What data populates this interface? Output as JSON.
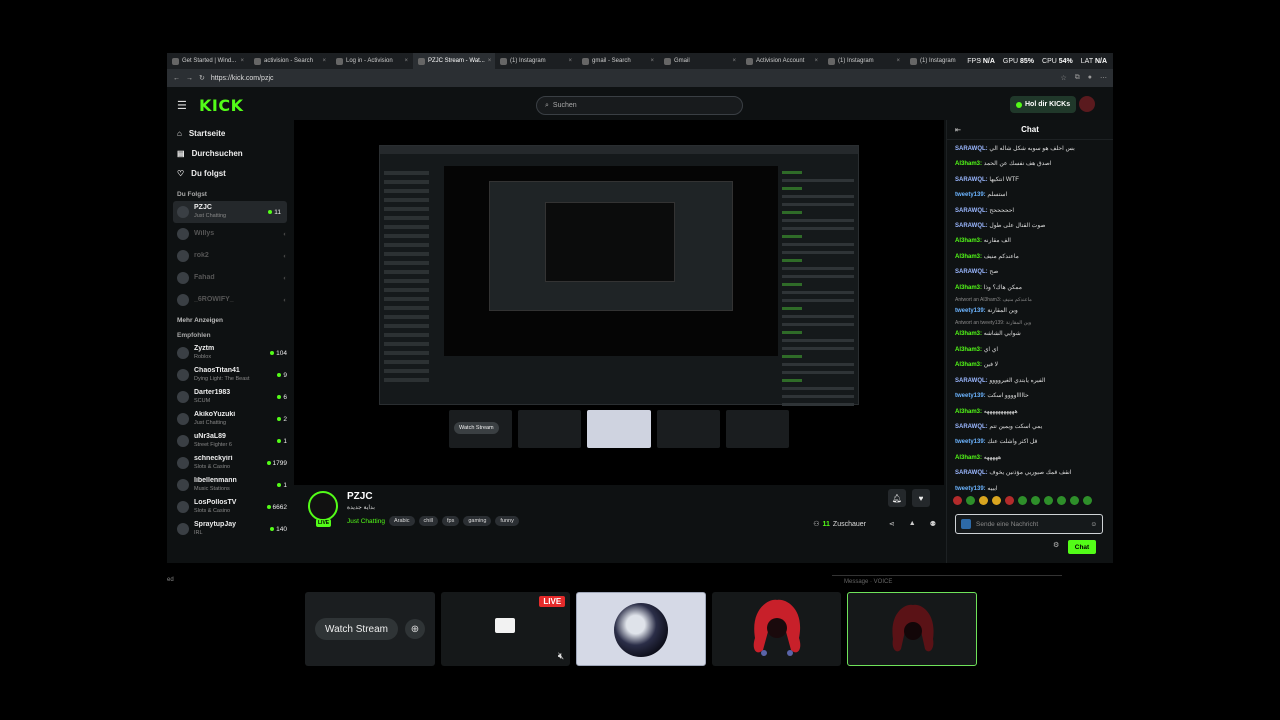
{
  "browser": {
    "tabs": [
      {
        "label": "Get Started | Wind...",
        "active": false
      },
      {
        "label": "activision - Search",
        "active": false
      },
      {
        "label": "Log in - Activision",
        "active": false
      },
      {
        "label": "PZJC Stream - Wat...",
        "active": true
      },
      {
        "label": "(1) Instagram",
        "active": false
      },
      {
        "label": "gmail - Search",
        "active": false
      },
      {
        "label": "Gmail",
        "active": false
      },
      {
        "label": "Activision Account",
        "active": false
      },
      {
        "label": "(1) Instagram",
        "active": false
      },
      {
        "label": "(1) Instagram",
        "active": false
      }
    ],
    "url": "https://kick.com/pzjc",
    "stats": {
      "fps_label": "FPS",
      "fps": "N/A",
      "gpu_label": "GPU",
      "gpu": "85%",
      "cpu_label": "CPU",
      "cpu": "54%",
      "lat_label": "LAT",
      "lat": "N/A"
    }
  },
  "header": {
    "logo": "KICK",
    "search_placeholder": "Suchen",
    "get_kicks": "Hol dir KICKs"
  },
  "sidebar": {
    "nav": [
      {
        "label": "Startseite",
        "icon": "home-icon"
      },
      {
        "label": "Durchsuchen",
        "icon": "browse-icon"
      },
      {
        "label": "Du folgst",
        "icon": "heart-icon"
      }
    ],
    "following_title": "Du Folgst",
    "following": [
      {
        "name": "PZJC",
        "category": "Just Chatting",
        "viewers": "11",
        "online": true
      },
      {
        "name": "Willys",
        "category": "",
        "viewers": "",
        "online": false
      },
      {
        "name": "rok2",
        "category": "",
        "viewers": "",
        "online": false
      },
      {
        "name": "Fahad",
        "category": "",
        "viewers": "",
        "online": false
      },
      {
        "name": "_6ROWIFY_",
        "category": "",
        "viewers": "",
        "online": false
      }
    ],
    "show_more": "Mehr Anzeigen",
    "recommended_title": "Empfohlen",
    "recommended": [
      {
        "name": "Zyztm",
        "category": "Roblox",
        "viewers": "104"
      },
      {
        "name": "ChaosTitan41",
        "category": "Dying Light: The Beast",
        "viewers": "9"
      },
      {
        "name": "Darter1983",
        "category": "SCUM",
        "viewers": "6"
      },
      {
        "name": "AkikoYuzuki",
        "category": "Just Chatting",
        "viewers": "2"
      },
      {
        "name": "uNr3aL89",
        "category": "Street Fighter 6",
        "viewers": "1"
      },
      {
        "name": "schneckyiri",
        "category": "Slots & Casino",
        "viewers": "1799"
      },
      {
        "name": "libellenmann",
        "category": "Music Stations",
        "viewers": "1"
      },
      {
        "name": "LosPollosTV",
        "category": "Slots & Casino",
        "viewers": "6662"
      },
      {
        "name": "SpraytupJay",
        "category": "IRL",
        "viewers": "140"
      }
    ]
  },
  "stream": {
    "channel": "PZJC",
    "title": "بداية جديدة",
    "category": "Just Chatting",
    "tags": [
      "Arabic",
      "chill",
      "fps",
      "gaming",
      "funny"
    ],
    "live_label": "LIVE",
    "viewers": "11",
    "viewers_label": "Zuschauer",
    "watch_stream": "Watch Stream"
  },
  "chat": {
    "title": "Chat",
    "messages": [
      {
        "user": "SARAWQL:",
        "text": "بس احلف هو سوبه شكل شاله الي",
        "color": "#9ab7ff",
        "reply": ""
      },
      {
        "user": "Al3ham3:",
        "text": "اصدق هف نفسك عن الحمد",
        "color": "#53fc18",
        "reply": ""
      },
      {
        "user": "SARAWQL:",
        "text": "انتكيها WTF",
        "color": "#9ab7ff",
        "reply": ""
      },
      {
        "user": "tweety139:",
        "text": "استسلم",
        "color": "#6cb4ff",
        "reply": ""
      },
      {
        "user": "SARAWQL:",
        "text": "احححححح",
        "color": "#9ab7ff",
        "reply": ""
      },
      {
        "user": "SARAWQL:",
        "text": "صوت القتال على طول",
        "color": "#9ab7ff",
        "reply": ""
      },
      {
        "user": "Al3ham3:",
        "text": "الف مقارنه",
        "color": "#53fc18",
        "reply": ""
      },
      {
        "user": "Al3ham3:",
        "text": "ماعندكم منيف",
        "color": "#53fc18",
        "reply": ""
      },
      {
        "user": "SARAWQL:",
        "text": "صح",
        "color": "#9ab7ff",
        "reply": ""
      },
      {
        "user": "Al3ham3:",
        "text": "ممكن هاك؟ وذا",
        "color": "#53fc18",
        "reply": ""
      },
      {
        "user": "tweety139:",
        "text": "وين المقارنة",
        "color": "#6cb4ff",
        "reply": "Antwort an Al3ham3: ماعندكم منيف"
      },
      {
        "user": "Al3ham3:",
        "text": "شوايي الشاشه",
        "color": "#53fc18",
        "reply": "Antwort an tweety139: وين المقارنة"
      },
      {
        "user": "Al3ham3:",
        "text": "اي اي",
        "color": "#53fc18",
        "reply": ""
      },
      {
        "user": "Al3ham3:",
        "text": "لا فين",
        "color": "#53fc18",
        "reply": ""
      },
      {
        "user": "SARAWQL:",
        "text": "الفيره يابتدي الغيروووو",
        "color": "#9ab7ff",
        "reply": ""
      },
      {
        "user": "tweety139:",
        "text": "حاااااوووو اسكت",
        "color": "#6cb4ff",
        "reply": ""
      },
      {
        "user": "Al3ham3:",
        "text": "هههههههههههه",
        "color": "#53fc18",
        "reply": ""
      },
      {
        "user": "SARAWQL:",
        "text": "يمي اسكت ويمين تتم",
        "color": "#9ab7ff",
        "reply": ""
      },
      {
        "user": "tweety139:",
        "text": "قل اكثر واشلت عنك",
        "color": "#6cb4ff",
        "reply": ""
      },
      {
        "user": "Al3ham3:",
        "text": "هههههه",
        "color": "#53fc18",
        "reply": ""
      },
      {
        "user": "SARAWQL:",
        "text": "انقف قمك صيوريي مؤذنين يخوف",
        "color": "#9ab7ff",
        "reply": ""
      },
      {
        "user": "tweety139:",
        "text": "ايييه",
        "color": "#6cb4ff",
        "reply": ""
      }
    ],
    "input_placeholder": "Sende eine Nachricht",
    "send_label": "Chat"
  },
  "overlay": {
    "below_left": "ed",
    "message_placeholder": "Message  ·  VOICE",
    "watch_stream": "Watch Stream",
    "live_badge": "LIVE"
  }
}
